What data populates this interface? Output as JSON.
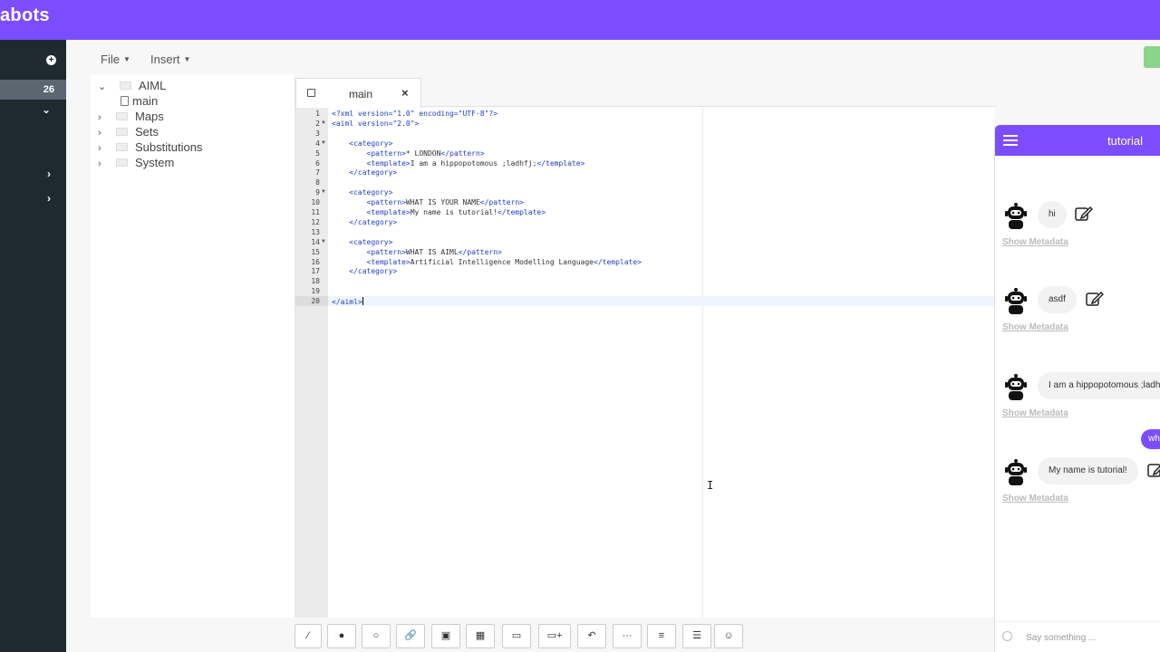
{
  "app": {
    "brand": "abots"
  },
  "rail": {
    "count": "26"
  },
  "menubar": {
    "file": "File",
    "insert": "Insert"
  },
  "tree": [
    {
      "label": "AIML",
      "expanded": true,
      "type": "folder"
    },
    {
      "label": "main",
      "type": "file"
    },
    {
      "label": "Maps",
      "type": "folder"
    },
    {
      "label": "Sets",
      "type": "folder"
    },
    {
      "label": "Substitutions",
      "type": "folder"
    },
    {
      "label": "System",
      "type": "folder"
    }
  ],
  "editor": {
    "tab": "main",
    "lines": [
      "<?xml version=\"1.0\" encoding=\"UTF-8\"?>",
      "<aiml version=\"2.0\">",
      "",
      "    <category>",
      "        <pattern>* LONDON</pattern>",
      "        <template>I am a hippopotomous ;ladhfj;</template>",
      "    </category>",
      "",
      "    <category>",
      "        <pattern>WHAT IS YOUR NAME</pattern>",
      "        <template>My name is tutorial!</template>",
      "    </category>",
      "",
      "    <category>",
      "        <pattern>WHAT IS AIML</pattern>",
      "        <template>Artificial Intelligence Modelling Language</template>",
      "    </category>",
      "",
      "",
      "</aiml>"
    ]
  },
  "toolbar": {
    "buttons": [
      "magic-wand-icon",
      "filled-circle-icon",
      "empty-circle-icon",
      "link-icon",
      "image-icon",
      "film-icon",
      "card-icon",
      "card-add-icon",
      "undo-icon",
      "ellipsis-icon",
      "ordered-list-icon",
      "unordered-list-icon",
      "smiley-icon"
    ]
  },
  "chat": {
    "title": "tutorial",
    "messages": [
      {
        "text": "hi",
        "meta": "Show Metadata"
      },
      {
        "text": "asdf",
        "meta": "Show Metadata"
      },
      {
        "text": "I am a hippopotomous ;ladh",
        "meta": "Show Metadata"
      },
      {
        "text": "My name is tutorial!",
        "meta": "Show Metadata"
      }
    ],
    "user_message": "wh",
    "input_placeholder": "Say something ..."
  },
  "colors": {
    "brand": "#7c4dff",
    "rail": "#1e2a30",
    "tag": "#1f3dc9"
  }
}
